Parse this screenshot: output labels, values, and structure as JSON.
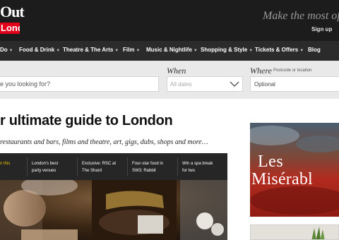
{
  "header": {
    "logo_top": "Out",
    "logo_bottom": "London",
    "tagline": "Make the most of yo",
    "signup_label": "Sign up"
  },
  "nav": {
    "items": [
      {
        "label": "Do"
      },
      {
        "label": "Food & Drink"
      },
      {
        "label": "Theatre & The Arts"
      },
      {
        "label": "Film"
      },
      {
        "label": "Music & Nightlife"
      },
      {
        "label": "Shopping & Style"
      },
      {
        "label": "Tickets & Offers"
      },
      {
        "label": "Blog"
      }
    ]
  },
  "search": {
    "what_placeholder": "e you looking for?",
    "when_label": "When",
    "when_value": "All dates",
    "where_label": "Where",
    "where_sublabel": "Postcode or location",
    "where_value": "Optional"
  },
  "main": {
    "headline": "r ultimate guide to London",
    "subline": "restaurants and bars, films and theatre, art, gigs, dubs, shops and more…",
    "features": [
      {
        "line1": "n this",
        "line2": "",
        "highlight": true
      },
      {
        "line1": "London's best",
        "line2": "party venues",
        "highlight": false
      },
      {
        "line1": "Exclusive: RSC at",
        "line2": "The Shard",
        "highlight": false
      },
      {
        "line1": "Four-star food in",
        "line2": "SW3: Rabbit",
        "highlight": false
      },
      {
        "line1": "Win a spa break",
        "line2": "for two",
        "highlight": false
      }
    ]
  },
  "promo": {
    "title_line1": "Les",
    "title_line2": "Misérabl"
  },
  "colors": {
    "header_bg": "#1c1c1c",
    "nav_bg": "#2b2b2b",
    "brand_red": "#e3001b",
    "highlight_yellow": "#f0c400",
    "search_bg": "#e9e9e9"
  },
  "icons": {
    "nav_chevron": "chevron-down-icon",
    "when_chevron": "chevron-down-icon"
  }
}
